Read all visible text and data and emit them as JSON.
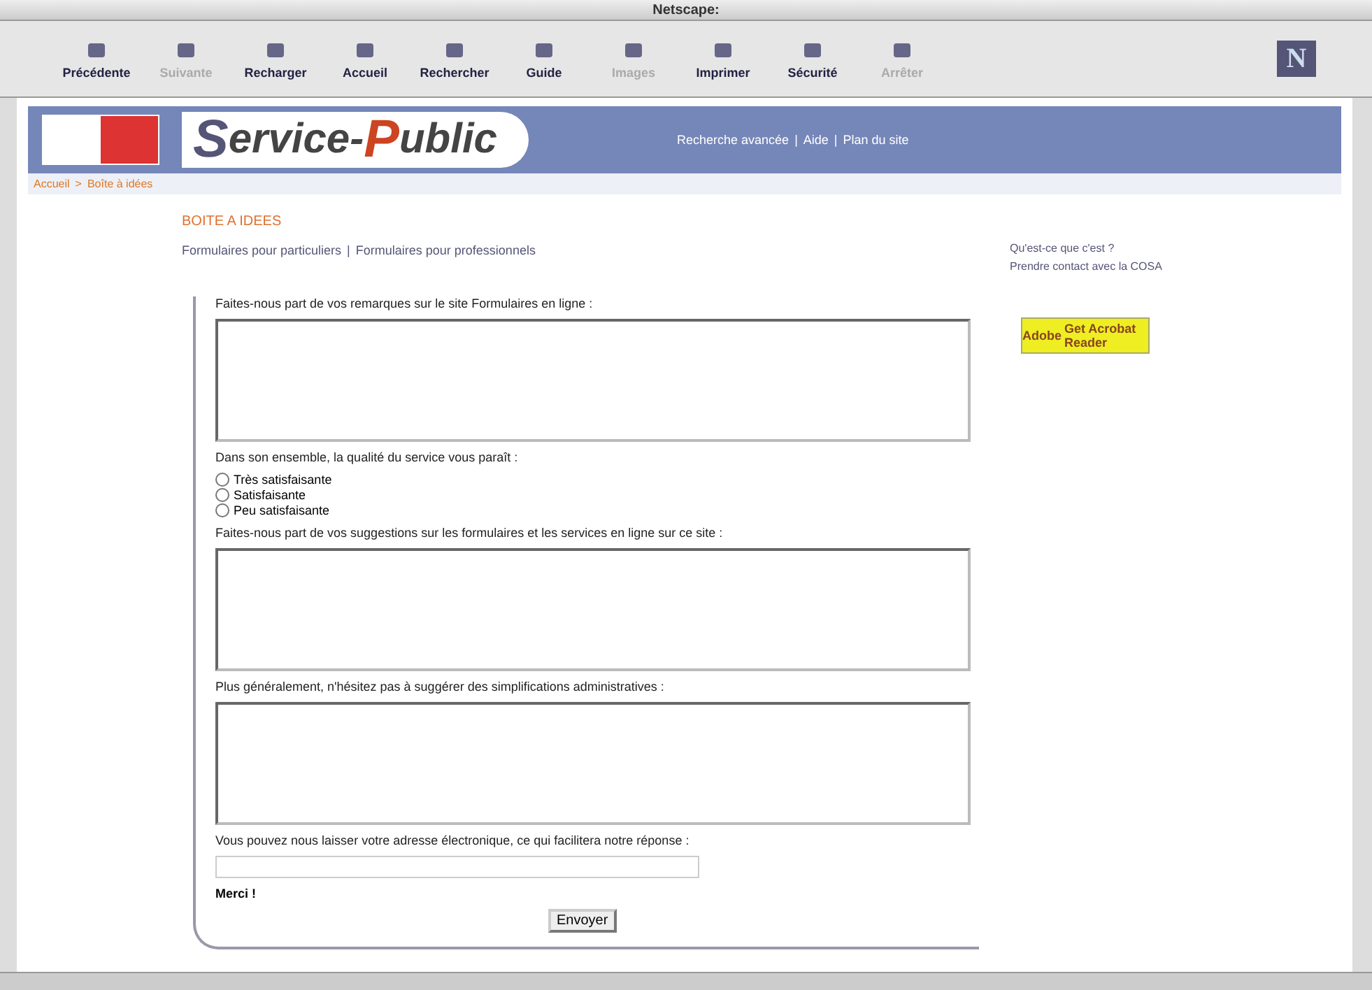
{
  "window": {
    "title": "Netscape:"
  },
  "toolbar": [
    {
      "label": "Précédente",
      "disabled": false
    },
    {
      "label": "Suivante",
      "disabled": true
    },
    {
      "label": "Recharger",
      "disabled": false
    },
    {
      "label": "Accueil",
      "disabled": false
    },
    {
      "label": "Rechercher",
      "disabled": false
    },
    {
      "label": "Guide",
      "disabled": false
    },
    {
      "label": "Images",
      "disabled": true
    },
    {
      "label": "Imprimer",
      "disabled": false
    },
    {
      "label": "Sécurité",
      "disabled": false
    },
    {
      "label": "Arrêter",
      "disabled": true
    }
  ],
  "brand_badge": "N",
  "banner": {
    "logo_first": "S",
    "logo_mid": "ervice-",
    "logo_second": "P",
    "logo_end": "ublic",
    "links": [
      "Recherche avancée",
      "Aide",
      "Plan du site"
    ],
    "separator": "|"
  },
  "breadcrumb": [
    "Accueil",
    "Boîte à idées"
  ],
  "breadcrumb_separator": ">",
  "page_title": "BOITE A IDEES",
  "form_links": [
    "Formulaires pour particuliers",
    "Formulaires pour professionnels"
  ],
  "form_links_separator": "|",
  "side_links": [
    "Qu'est-ce que c'est ?",
    "Prendre contact avec la COSA"
  ],
  "reader_badge": {
    "text": "Get Acrobat Reader",
    "brand": "Adobe"
  },
  "form": [
    {
      "kind": "textarea",
      "label": "Faites-nous part de vos remarques sur le site Formulaires en ligne :"
    },
    {
      "kind": "radios",
      "label": "Dans son ensemble, la qualité du service vous paraît :",
      "options": [
        {
          "label": "Très satisfaisante",
          "selected": false
        },
        {
          "label": "Satisfaisante",
          "selected": false
        },
        {
          "label": "Peu satisfaisante",
          "selected": false
        }
      ]
    },
    {
      "kind": "textarea",
      "label": "Faites-nous part de vos suggestions sur les formulaires et les services en ligne sur ce site :"
    },
    {
      "kind": "textarea",
      "label": "Plus généralement, n'hésitez pas à suggérer des simplifications administratives :"
    },
    {
      "kind": "input",
      "label": "Vous pouvez nous laisser votre adresse électronique, ce qui facilitera notre réponse :"
    }
  ],
  "thanks": "Merci !",
  "submit": "Envoyer"
}
